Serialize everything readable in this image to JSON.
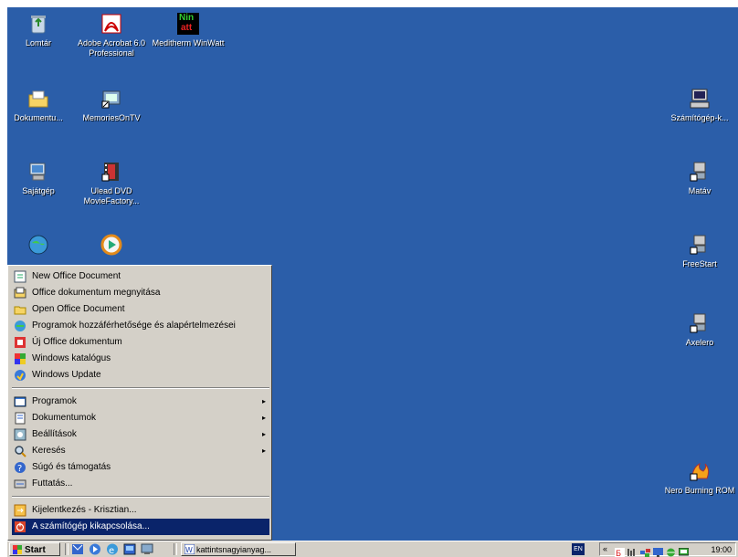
{
  "desktop": {
    "icons_left": [
      {
        "name": "recycle-bin",
        "label": "Lomtár"
      },
      {
        "name": "adobe-acrobat",
        "label": "Adobe Acrobat 6.0 Professional"
      },
      {
        "name": "meditherm-winwatt",
        "label": "Meditherm WinWatt"
      },
      {
        "name": "documents",
        "label": "Dokumentu..."
      },
      {
        "name": "memoriesontv",
        "label": "MemoriesOnTV"
      },
      {
        "name": "my-computer",
        "label": "Sajátgép"
      },
      {
        "name": "ulead-dvd",
        "label": "Ulead DVD MovieFactory..."
      }
    ],
    "icons_right": [
      {
        "name": "computer-k",
        "label": "Számítógép-k..."
      },
      {
        "name": "matav",
        "label": "Matáv"
      },
      {
        "name": "freestart",
        "label": "FreeStart"
      },
      {
        "name": "axelero",
        "label": "Axelero"
      },
      {
        "name": "nero",
        "label": "Nero Burning ROM"
      }
    ],
    "win_logo_text": "Nin",
    "win_logo_text2": "att"
  },
  "start_menu": {
    "top_items": [
      {
        "label": "New Office Document"
      },
      {
        "label": "Office dokumentum megnyitása"
      },
      {
        "label": "Open Office Document"
      },
      {
        "label": "Programok hozzáférhetősége és alapértelmezései"
      },
      {
        "label": "Új Office dokumentum"
      },
      {
        "label": "Windows katalógus"
      },
      {
        "label": "Windows Update"
      }
    ],
    "main_items": [
      {
        "label": "Programok",
        "submenu": true
      },
      {
        "label": "Dokumentumok",
        "submenu": true
      },
      {
        "label": "Beállítások",
        "submenu": true
      },
      {
        "label": "Keresés",
        "submenu": true
      },
      {
        "label": "Súgó és támogatás",
        "submenu": false
      },
      {
        "label": "Futtatás...",
        "submenu": false
      }
    ],
    "bottom_items": [
      {
        "label": "Kijelentkezés - Krisztian..."
      },
      {
        "label": "A számítógép kikapcsolása...",
        "selected": true
      }
    ],
    "submenu_arrow": "▸"
  },
  "taskbar": {
    "start_label": "Start",
    "task_button_label": "kattintsnagyianyag...",
    "lang": "EN",
    "tray_chevron": "«",
    "clock": "19:00"
  },
  "colors": {
    "desktop": "#2b5ea9",
    "menu_bg": "#d4d0c8",
    "selection": "#0a246a"
  }
}
